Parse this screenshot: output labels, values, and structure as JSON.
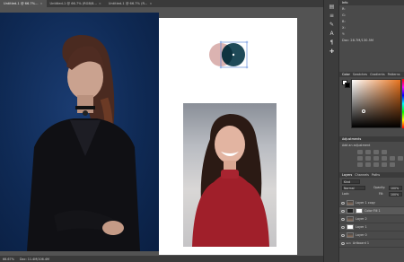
{
  "tabs": [
    {
      "label": "Untitled-1 @ 66.7%...",
      "close": "×",
      "active": true
    },
    {
      "label": "Untitled-1 @ 66.7% (RGB/8...",
      "close": "×",
      "active": false
    },
    {
      "label": "Untitled-1 @ 66.7% (R...",
      "close": "×",
      "active": false
    }
  ],
  "status_zoom": "66.67%",
  "status_doc": "Doc: 11.4M/106.4M",
  "info_panel": {
    "tabs": [
      "Info"
    ],
    "rows": [
      "R:",
      "G:",
      "B:",
      "X:",
      "Y:"
    ],
    "doc_line": "Doc: 28.7M/130.5M"
  },
  "color_panel": {
    "tabs": [
      "Color",
      "Swatches",
      "Gradients",
      "Patterns"
    ]
  },
  "adjustments_panel": {
    "title": "Adjustments",
    "subtitle": "Add an adjustment"
  },
  "layers_panel": {
    "tabs": [
      "Layers",
      "Channels",
      "Paths"
    ],
    "kind": "Kind",
    "mode": "Normal",
    "opacity_label": "Opacity:",
    "opacity": "100%",
    "fill_label": "Fill:",
    "fill": "100%",
    "lock": "Lock:",
    "layers": [
      {
        "name": "Layer 1 copy",
        "selected": false
      },
      {
        "name": "Color Fill 1",
        "selected": true
      },
      {
        "name": "Layer 2",
        "selected": false
      },
      {
        "name": "Layer 1",
        "selected": false
      },
      {
        "name": "Layer 0",
        "selected": false
      },
      {
        "name": "Artboard 1",
        "selected": false
      }
    ]
  },
  "colors": {
    "accent_pink": "#dbb3b1",
    "accent_teal": "#1f4a58",
    "left_bg": "#0f2a55",
    "foreground": "#ffffff",
    "background": "#000000"
  }
}
